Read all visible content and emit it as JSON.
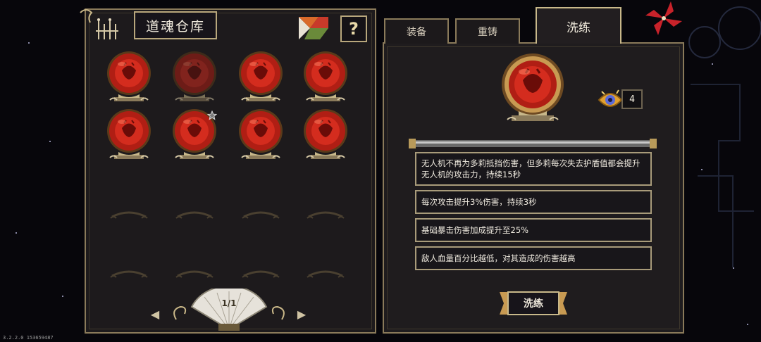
{
  "warehouse": {
    "title": "道魂仓库",
    "page_indicator": "1/1",
    "orbs": [
      {
        "row": 1,
        "col": 1,
        "dimmed": false,
        "starred": false
      },
      {
        "row": 1,
        "col": 2,
        "dimmed": true,
        "starred": false
      },
      {
        "row": 1,
        "col": 3,
        "dimmed": false,
        "starred": false
      },
      {
        "row": 1,
        "col": 4,
        "dimmed": false,
        "starred": false
      },
      {
        "row": 2,
        "col": 1,
        "dimmed": false,
        "starred": false
      },
      {
        "row": 2,
        "col": 2,
        "dimmed": false,
        "starred": true
      },
      {
        "row": 2,
        "col": 3,
        "dimmed": false,
        "starred": false
      },
      {
        "row": 2,
        "col": 4,
        "dimmed": false,
        "starred": false
      }
    ],
    "empty_slot_count": 8,
    "help_label": "?",
    "prev_arrow": "◀",
    "next_arrow": "▶"
  },
  "tabs": [
    {
      "label": "装备",
      "active": false
    },
    {
      "label": "重铸",
      "active": false
    },
    {
      "label": "洗练",
      "active": true
    }
  ],
  "detail": {
    "material_count": "4",
    "affixes": [
      "无人机不再为多莉抵挡伤害，但多莉每次失去护盾值都会提升无人机的攻击力，持续15秒",
      "每次攻击提升3%伤害，持续3秒",
      "基础暴击伤害加成提升至25%",
      "敌人血量百分比越低，对其造成的伤害越高"
    ],
    "refine_button": "洗练"
  },
  "version": "3.2.2.0 153659487",
  "colors": {
    "orb_red": "#b01e14",
    "frame_gold": "#b8a77c",
    "panel_bg": "#1d1a1c"
  },
  "icons": [
    "ornament-icon",
    "puzzle-icon",
    "help-icon",
    "eye-icon",
    "pinwheel-icon",
    "star-icon",
    "fan-icon"
  ]
}
